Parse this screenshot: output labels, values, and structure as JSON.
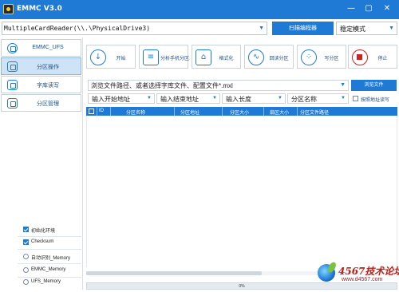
{
  "window": {
    "title": "EMMC V3.0",
    "controls": {
      "minimize": "—",
      "maximize": "▢",
      "close": "✕"
    },
    "accent_color": "#1f7ad6"
  },
  "topbar": {
    "device_value": "MultipleCardReader(\\\\.\\PhysicalDrive3)",
    "scan_programmer_label": "扫描编程器",
    "mode_value": "稳定模式"
  },
  "sidebar": {
    "items": [
      {
        "label": "EMMC_UFS",
        "icon": "chip-icon"
      },
      {
        "label": "分区操作",
        "icon": "partition-icon"
      },
      {
        "label": "字库读写",
        "icon": "rw-icon"
      },
      {
        "label": "分区管理",
        "icon": "manage-icon"
      }
    ],
    "options": [
      {
        "label": "初始化环境",
        "type": "checkbox",
        "checked": true
      },
      {
        "label": "Checksum",
        "type": "checkbox",
        "checked": true
      },
      {
        "label": "自动识别_Memory",
        "type": "radio",
        "checked": false
      },
      {
        "label": "EMMC_Memory",
        "type": "radio",
        "checked": false
      },
      {
        "label": "UFS_Memory",
        "type": "radio",
        "checked": false
      }
    ]
  },
  "toolbar": {
    "buttons": [
      {
        "label": "开始",
        "icon": "download-icon",
        "glyph": "↓"
      },
      {
        "label": "分析手机分区",
        "icon": "analyze-icon",
        "glyph": "≡"
      },
      {
        "label": "格式化",
        "icon": "format-icon",
        "glyph": "⌂"
      },
      {
        "label": "回读分区",
        "icon": "readback-icon",
        "glyph": "∿"
      },
      {
        "label": "写分区",
        "icon": "write-icon",
        "glyph": "⁘"
      },
      {
        "label": "停止",
        "icon": "stop-icon",
        "glyph": ""
      }
    ]
  },
  "file": {
    "placeholder_value": "浏览文件路径、或者选择字库文件、配置文件*.mxl",
    "browse_label": "浏览文件"
  },
  "params": {
    "start_addr": "输入开始地址",
    "end_addr": "输入结束地址",
    "length": "输入长度",
    "partition_name": "分区名称",
    "raw_rw_label": "按照地址读写"
  },
  "table": {
    "columns": [
      "ID",
      "分区名称",
      "分区地址",
      "分区大小",
      "扇区大小",
      "分区文件路径"
    ]
  },
  "progress": {
    "value": 0,
    "label": "0%"
  },
  "watermark": {
    "brand": "4567技术论坛",
    "url": "www.d4567.com"
  }
}
